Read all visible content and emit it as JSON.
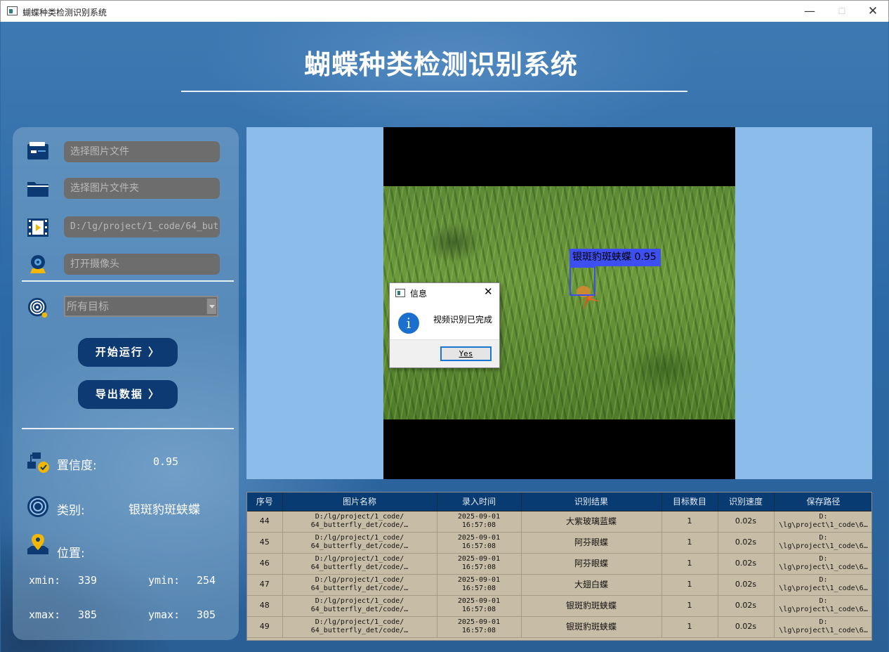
{
  "window": {
    "title": "蝴蝶种类检测识别系统",
    "min_glyph": "—",
    "max_glyph": "☐",
    "close_glyph": "✕"
  },
  "header": {
    "title": "蝴蝶种类检测识别系统"
  },
  "inputs": {
    "image_file_placeholder": "选择图片文件",
    "image_folder_placeholder": "选择图片文件夹",
    "video_path_value": "D:/lg/project/1_code/64_but",
    "camera_placeholder": "打开摄像头",
    "target_select_value": "所有目标"
  },
  "buttons": {
    "start_label": "开始运行 〉",
    "export_label": "导出数据 〉"
  },
  "result": {
    "confidence_label": "置信度:",
    "confidence_value": "0.95",
    "class_label": "类别:",
    "class_value": "银斑豹斑蛱蝶",
    "position_label": "位置:",
    "xmin_label": "xmin:",
    "xmin_value": "339",
    "ymin_label": "ymin:",
    "ymin_value": "254",
    "xmax_label": "xmax:",
    "xmax_value": "385",
    "ymax_label": "ymax:",
    "ymax_value": "305"
  },
  "detection": {
    "label": "银斑豹斑蛱蝶 0.95",
    "box_color": "#3d4ff0"
  },
  "dialog": {
    "title": "信息",
    "message": "视频识别已完成",
    "yes_label": "Yes",
    "info_glyph": "i",
    "close_glyph": "✕"
  },
  "table": {
    "headers": [
      "序号",
      "图片名称",
      "录入时间",
      "识别结果",
      "目标数目",
      "识别速度",
      "保存路径"
    ],
    "rows": [
      {
        "id": "44",
        "name": "D:/lg/project/1_code/\n64_butterfly_det/code/…",
        "time": "2025-09-01\n16:57:08",
        "result": "大紫玻璃蓝蝶",
        "count": "1",
        "speed": "0.02s",
        "path": "D:\n\\lg\\project\\1_code\\6…"
      },
      {
        "id": "45",
        "name": "D:/lg/project/1_code/\n64_butterfly_det/code/…",
        "time": "2025-09-01\n16:57:08",
        "result": "阿芬眼蝶",
        "count": "1",
        "speed": "0.02s",
        "path": "D:\n\\lg\\project\\1_code\\6…"
      },
      {
        "id": "46",
        "name": "D:/lg/project/1_code/\n64_butterfly_det/code/…",
        "time": "2025-09-01\n16:57:08",
        "result": "阿芬眼蝶",
        "count": "1",
        "speed": "0.02s",
        "path": "D:\n\\lg\\project\\1_code\\6…"
      },
      {
        "id": "47",
        "name": "D:/lg/project/1_code/\n64_butterfly_det/code/…",
        "time": "2025-09-01\n16:57:08",
        "result": "大翅白蝶",
        "count": "1",
        "speed": "0.02s",
        "path": "D:\n\\lg\\project\\1_code\\6…"
      },
      {
        "id": "48",
        "name": "D:/lg/project/1_code/\n64_butterfly_det/code/…",
        "time": "2025-09-01\n16:57:08",
        "result": "银斑豹斑蛱蝶",
        "count": "1",
        "speed": "0.02s",
        "path": "D:\n\\lg\\project\\1_code\\6…"
      },
      {
        "id": "49",
        "name": "D:/lg/project/1_code/\n64_butterfly_det/code/…",
        "time": "2025-09-01\n16:57:08",
        "result": "银斑豹斑蛱蝶",
        "count": "1",
        "speed": "0.02s",
        "path": "D:\n\\lg\\project\\1_code\\6…"
      }
    ]
  },
  "colors": {
    "accent_button": "#0d3a73",
    "table_header": "#073b72",
    "table_body": "#c7bca5",
    "video_bg": "#8cbce9",
    "icon_gold": "#f2b705",
    "icon_navy": "#0d3a73"
  }
}
